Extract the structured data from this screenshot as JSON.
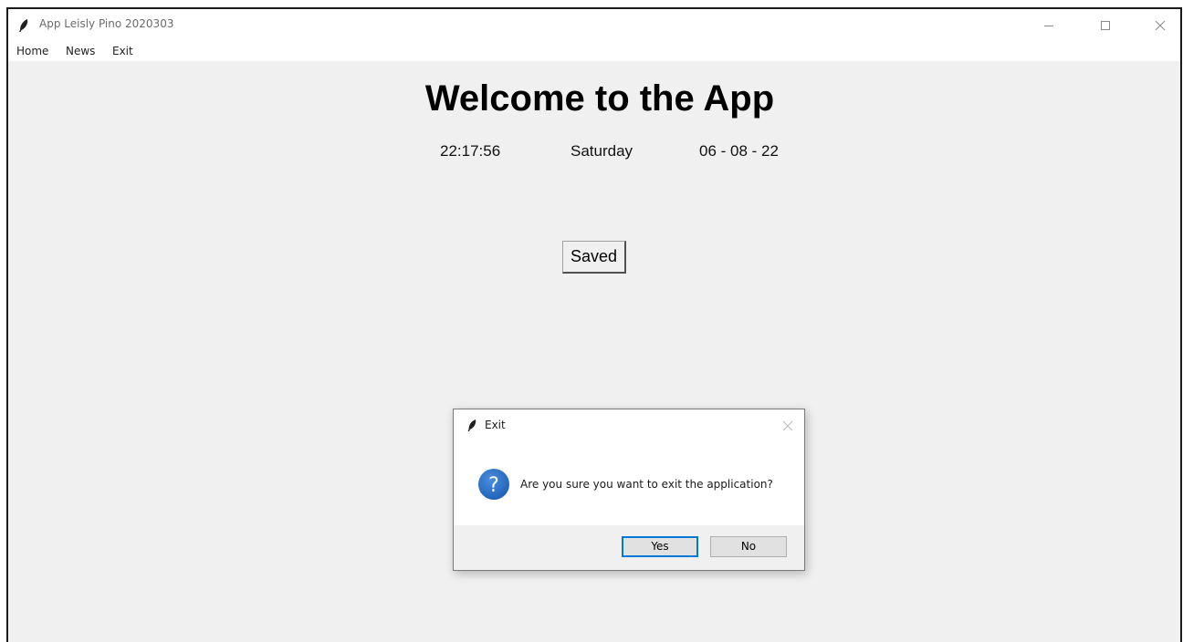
{
  "window": {
    "title": "App Leisly Pino 2020303"
  },
  "menu": {
    "items": [
      "Home",
      "News",
      "Exit"
    ]
  },
  "main": {
    "heading": "Welcome to the App",
    "time": "22:17:56",
    "day": "Saturday",
    "date": "06 - 08 - 22",
    "saved_button": "Saved"
  },
  "dialog": {
    "title": "Exit",
    "message": "Are you sure you want to exit the application?",
    "yes_label": "Yes",
    "no_label": "No",
    "icon": "question-icon"
  },
  "colors": {
    "background": "#f0f0f0",
    "accent": "#0078d7",
    "question_icon": "#1d5fb4"
  }
}
